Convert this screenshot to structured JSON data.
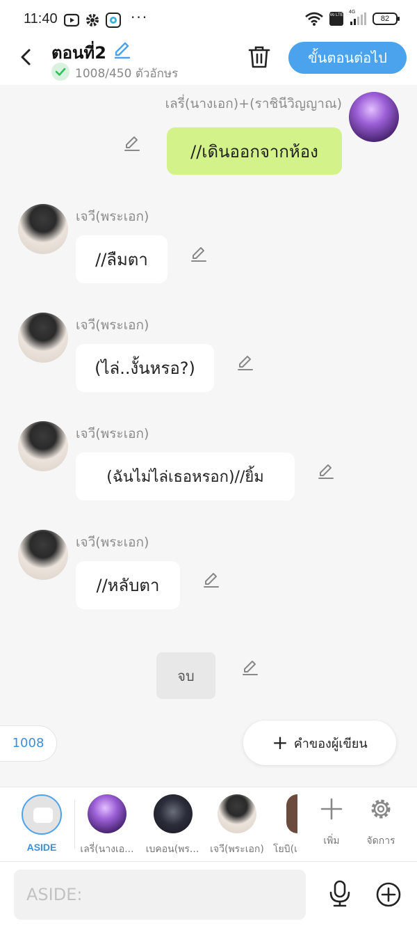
{
  "status_bar": {
    "time": "11:40",
    "icons": [
      "youtube-icon",
      "gear-icon",
      "app-icon"
    ],
    "dots": "···",
    "network": "4G",
    "volte": "Vo LTE",
    "battery": "82"
  },
  "header": {
    "title": "ตอนที่2",
    "char_count": "1008/450 ตัวอักษร",
    "next_button": "ขั้นตอนต่อไป"
  },
  "messages": [
    {
      "side": "right",
      "name": "เลรี่(นางเอก)+(ราชินีวิญญาณ)",
      "text": "//เดินออกจากห้อง"
    },
    {
      "side": "left",
      "name": "เจวี(พระเอก)",
      "text": "//ลืมตา"
    },
    {
      "side": "left",
      "name": "เจวี(พระเอก)",
      "text": "(ไล่..งั้นหรอ?)"
    },
    {
      "side": "left",
      "name": "เจวี(พระเอก)",
      "text": "(ฉันไม่ไล่เธอหรอก)//ยิ้ม"
    },
    {
      "side": "left",
      "name": "เจวี(พระเอก)",
      "text": "//หลับตา"
    },
    {
      "side": "center",
      "text": "จบ"
    }
  ],
  "counter": "1008",
  "author_note": {
    "plus": "+",
    "label": "คำของผู้เขียน"
  },
  "character_bar": {
    "aside_label": "ASIDE",
    "characters": [
      {
        "label": "เลรี่(นางเอ...",
        "color": "#7a3fb8"
      },
      {
        "label": "เบคอน(พร...",
        "color": "#2b2d3a"
      },
      {
        "label": "เจวี(พระเอก)",
        "color": "#3a3a3a"
      },
      {
        "label": "โยบิ(เ",
        "color": "#6b4b3e"
      }
    ],
    "add_label": "เพิ่ม",
    "manage_label": "จัดการ"
  },
  "input": {
    "placeholder": "ASIDE:"
  },
  "colors": {
    "accent": "#4aa3ec",
    "my_bubble": "#d3f38a",
    "background": "#f6f6f6"
  }
}
